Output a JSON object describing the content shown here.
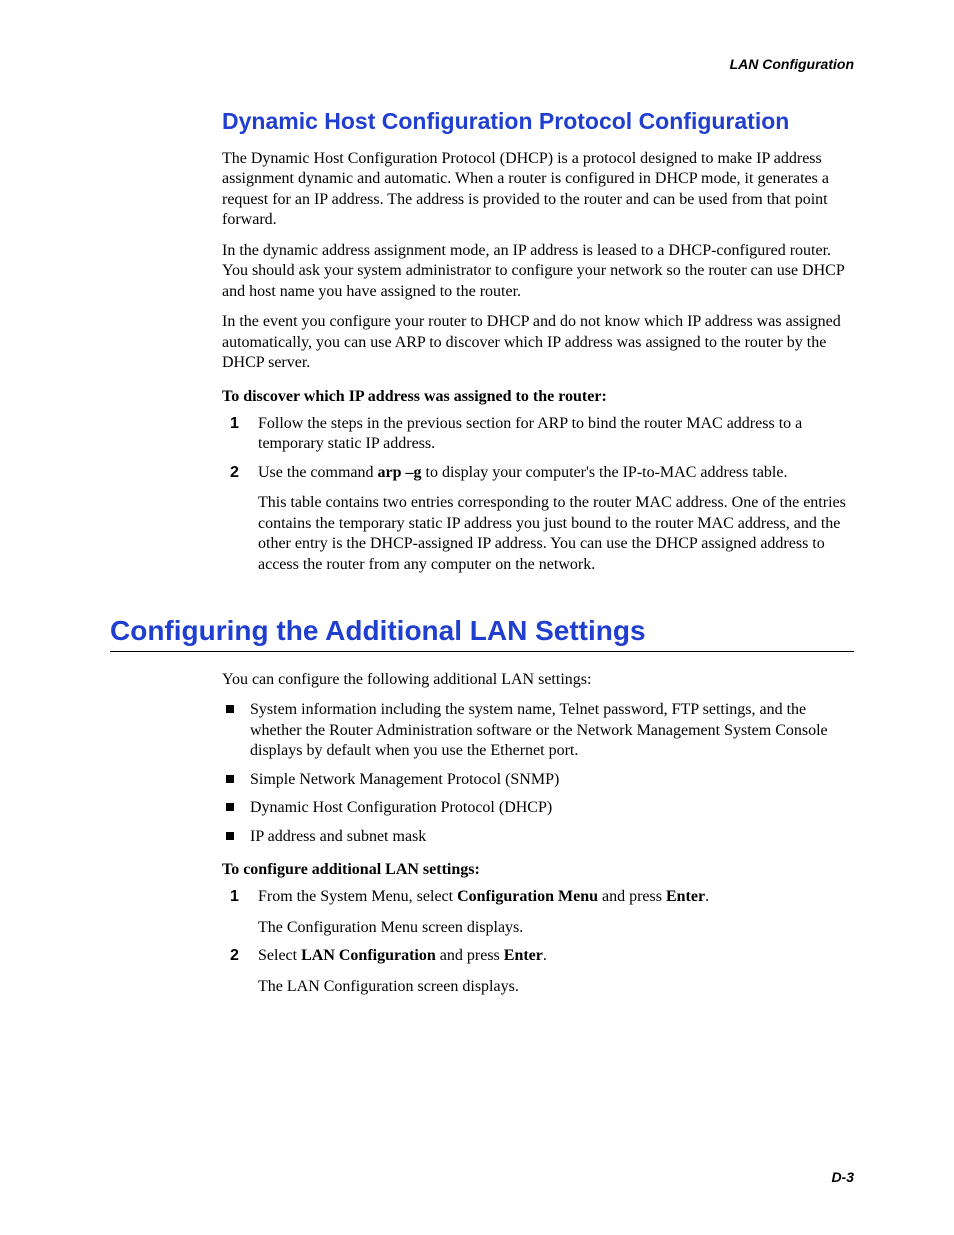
{
  "running_header": "LAN Configuration",
  "section_a": {
    "title": "Dynamic Host Configuration Protocol Configuration",
    "p1": "The Dynamic Host Configuration Protocol (DHCP) is a protocol designed to make IP address assignment dynamic and automatic. When a router is configured in DHCP mode, it generates a request for an IP address. The address is provided to the router and can be used from that point forward.",
    "p2": "In the dynamic address assignment mode, an IP address is leased to a DHCP-configured router. You should ask your system administrator to configure your network so the router can use DHCP and host name you have assigned to the router.",
    "p3": "In the event you configure your router to DHCP and do not know which IP address was assigned automatically, you can use ARP to discover which IP address was assigned to the router by the DHCP server.",
    "lead": "To discover which IP address was assigned to the router:",
    "step1": "Follow the steps in the previous section for ARP to bind the router MAC address to a temporary static IP address.",
    "step2_pre": "Use the command ",
    "step2_bold": "arp –g",
    "step2_post": " to display your computer's the IP-to-MAC address table.",
    "step2_para": "This table contains two entries corresponding to the router MAC address. One of the entries contains the temporary static IP address you just bound to the router MAC address, and the other entry is the DHCP-assigned IP address. You can use the DHCP assigned address to access the router from any computer on the network."
  },
  "section_b": {
    "title": "Configuring the Additional LAN Settings",
    "intro": "You can configure the following additional LAN settings:",
    "bullets": {
      "b1": "System information including the system name, Telnet password, FTP settings, and the whether the Router Administration software or the Network Management System Console displays by default when you use the Ethernet port.",
      "b2": "Simple Network Management Protocol (SNMP)",
      "b3": "Dynamic Host Configuration Protocol (DHCP)",
      "b4": "IP address and subnet mask"
    },
    "lead": "To configure additional LAN settings:",
    "step1_pre": "From the System Menu, select ",
    "step1_bold1": "Configuration Menu",
    "step1_mid": " and press ",
    "step1_bold2": "Enter",
    "step1_post": ".",
    "step1_para": "The Configuration Menu screen displays.",
    "step2_pre": "Select ",
    "step2_bold1": "LAN Configuration",
    "step2_mid": " and press ",
    "step2_bold2": "Enter",
    "step2_post": ".",
    "step2_para": "The LAN Configuration screen displays."
  },
  "footer": "D-3"
}
